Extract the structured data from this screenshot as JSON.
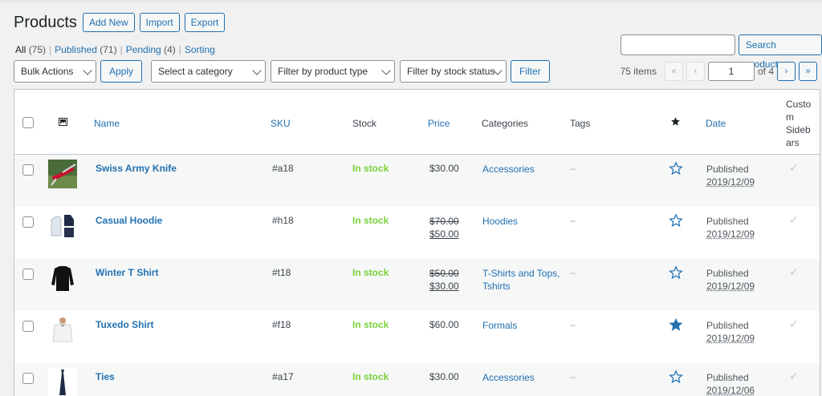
{
  "page": {
    "title": "Products",
    "buttons": {
      "add_new": "Add New",
      "import": "Import",
      "export": "Export"
    }
  },
  "status_filters": [
    {
      "label": "All",
      "count": "(75)",
      "current": true
    },
    {
      "label": "Published",
      "count": "(71)"
    },
    {
      "label": "Pending",
      "count": "(4)"
    },
    {
      "label": "Sorting",
      "count": ""
    }
  ],
  "search": {
    "value": "",
    "button": "Search products"
  },
  "tablenav": {
    "bulk_actions": "Bulk Actions",
    "apply": "Apply",
    "category": "Select a category",
    "product_type": "Filter by product type",
    "stock_status": "Filter by stock status",
    "filter": "Filter",
    "items": "75 items",
    "first": "«",
    "prev": "‹",
    "current_page": "1",
    "of": "of 4",
    "next": "›",
    "last": "»"
  },
  "columns": {
    "name": "Name",
    "sku": "SKU",
    "stock": "Stock",
    "price": "Price",
    "categories": "Categories",
    "tags": "Tags",
    "date": "Date",
    "custom_line1": "Custo",
    "custom_line2": "m",
    "custom_line3": "Sidebars",
    "custom_line3a": "Sideb",
    "custom_line3b": "ars"
  },
  "rows": [
    {
      "name": "Swiss Army Knife",
      "sku": "#a18",
      "stock": "In stock",
      "price": "$30.00",
      "old_price": "",
      "categories": "Accessories",
      "categories2": "",
      "tags": "–",
      "featured": false,
      "status": "Published",
      "date": "2019/12/09",
      "check": "✓"
    },
    {
      "name": "Casual Hoodie",
      "sku": "#h18",
      "stock": "In stock",
      "price": "$50.00",
      "old_price": "$70.00",
      "categories": "Hoodies",
      "categories2": "",
      "tags": "–",
      "featured": false,
      "status": "Published",
      "date": "2019/12/09",
      "check": "✓"
    },
    {
      "name": "Winter T Shirt",
      "sku": "#t18",
      "stock": "In stock",
      "price": "$30.00",
      "old_price": "$50.00",
      "categories": "T-Shirts and Tops,",
      "categories2": "Tshirts",
      "tags": "–",
      "featured": false,
      "status": "Published",
      "date": "2019/12/09",
      "check": "✓"
    },
    {
      "name": "Tuxedo Shirt",
      "sku": "#f18",
      "stock": "In stock",
      "price": "$60.00",
      "old_price": "",
      "categories": "Formals",
      "categories2": "",
      "tags": "–",
      "featured": true,
      "status": "Published",
      "date": "2019/12/09",
      "check": "✓"
    },
    {
      "name": "Ties",
      "sku": "#a17",
      "stock": "In stock",
      "price": "$30.00",
      "old_price": "",
      "categories": "Accessories",
      "categories2": "",
      "tags": "–",
      "featured": false,
      "status": "Published",
      "date": "2019/12/06",
      "check": "✓"
    }
  ],
  "colors": {
    "link": "#2271b1",
    "in_stock": "#7ad03a",
    "featured_star": "#2271b1"
  },
  "icons": {
    "image_col": "image-icon",
    "featured_col": "star-icon"
  }
}
